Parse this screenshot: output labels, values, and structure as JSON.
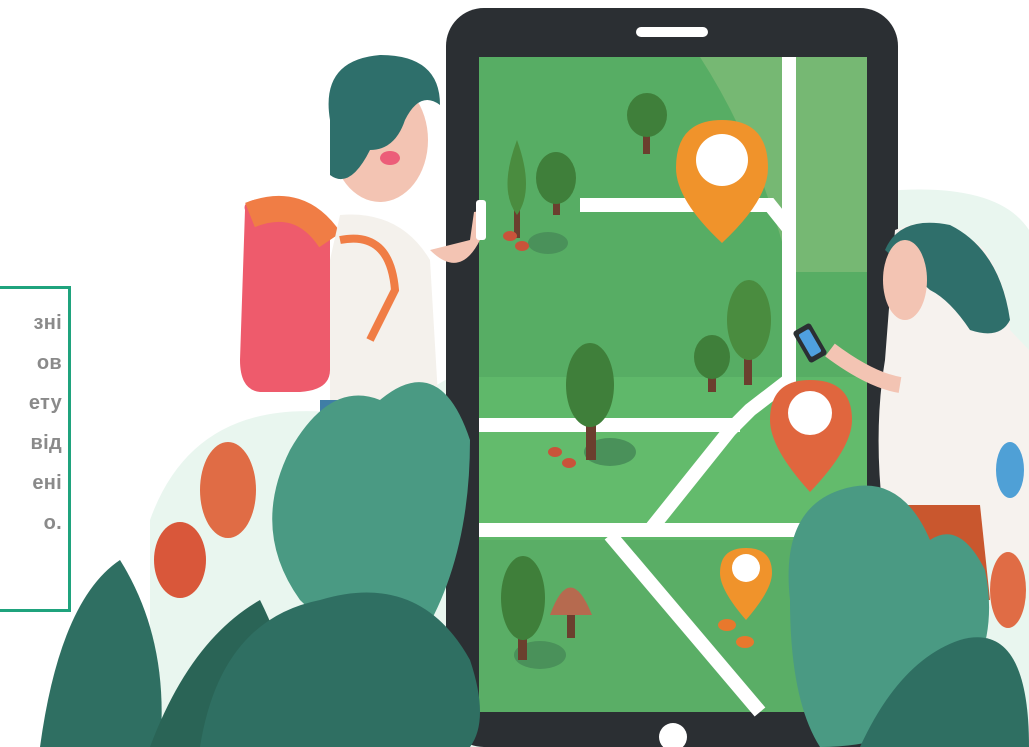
{
  "note": {
    "lines": [
      "зні",
      "ов",
      "ету",
      "від",
      "ені",
      "о."
    ]
  },
  "colors": {
    "phone_frame": "#2b2f33",
    "map_green": "#5fb86a",
    "map_dark_green": "#4e9e5c",
    "road": "#ffffff",
    "pin_orange": "#f0932b",
    "pin_red": "#e0663e",
    "accent_teal": "#1fa37d",
    "leaf_dark": "#2f6f62",
    "leaf_light": "#4a9a83"
  },
  "icons": {
    "map_pin_large": "map-pin-icon",
    "map_pin_medium": "map-pin-icon",
    "map_pin_small": "map-pin-icon",
    "home_button": "home-button-icon",
    "speaker": "speaker-icon"
  }
}
